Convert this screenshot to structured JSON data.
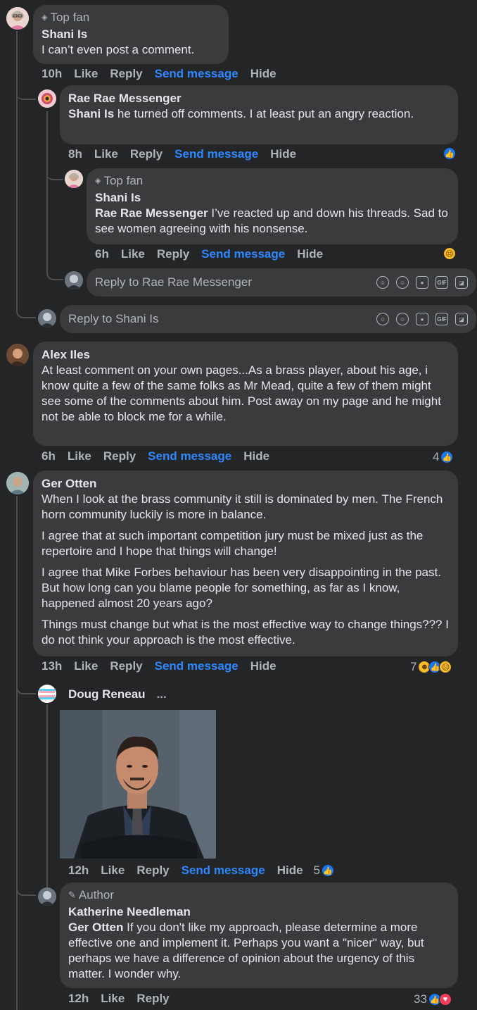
{
  "comments": {
    "shani": {
      "badge": "Top fan",
      "name": "Shani Is",
      "text": "I can’t even post a comment.",
      "time": "10h"
    },
    "rae": {
      "name": "Rae Rae Messenger",
      "mention": "Shani Is",
      "text": " he turned off comments. I at least put an angry reaction.",
      "time": "8h"
    },
    "shani2": {
      "badge": "Top fan",
      "name": "Shani Is",
      "mention": "Rae Rae Messenger",
      "text": " I’ve reacted up and down his threads. Sad to see women agreeing with his nonsense.",
      "time": "6h"
    },
    "alex": {
      "name": "Alex Iles",
      "text": "At least comment on your own pages...As a brass player, about his age, i know quite a few of the same folks as Mr Mead, quite a few of them might see some of the comments about him. Post away on my page and he might not be able to block me for a while.",
      "time": "6h",
      "reaction_count": "4"
    },
    "ger": {
      "name": "Ger Otten",
      "paragraphs": [
        "When I look at the brass community it still is dominated by men. The French horn community luckily is more in balance.",
        "I agree that at such important competition jury must be mixed just as the repertoire and I hope that things will change!",
        "I agree that Mike Forbes behaviour has been very disappointing in the past. But how long can you blame people for something, as far as I know, happened almost 20 years ago?",
        "Things must change but what is the most effective way to change things??? I do not think your approach is the most effective."
      ],
      "time": "13h",
      "reaction_count": "7"
    },
    "doug": {
      "name": "Doug Reneau",
      "more": "...",
      "time": "12h",
      "reaction_count": "5"
    },
    "katherine": {
      "badge": "Author",
      "name": "Katherine Needleman",
      "mention": "Ger Otten",
      "text": " If you don't like my approach, please determine a more effective one and implement it. Perhaps you want a \"nicer\" way, but perhaps we have a difference of opinion about the urgency of this matter. I wonder why.",
      "time": "12h",
      "reaction_count": "33"
    }
  },
  "actions": {
    "like": "Like",
    "reply": "Reply",
    "send_message": "Send message",
    "hide": "Hide"
  },
  "reply_boxes": {
    "rae": "Reply to Rae Rae Messenger",
    "shani": "Reply to Shani Is"
  },
  "colors": {
    "background": "#242526",
    "bubble": "#3a3b3c",
    "link_blue": "#2d88ff",
    "secondary_text": "#b0b3b8"
  }
}
